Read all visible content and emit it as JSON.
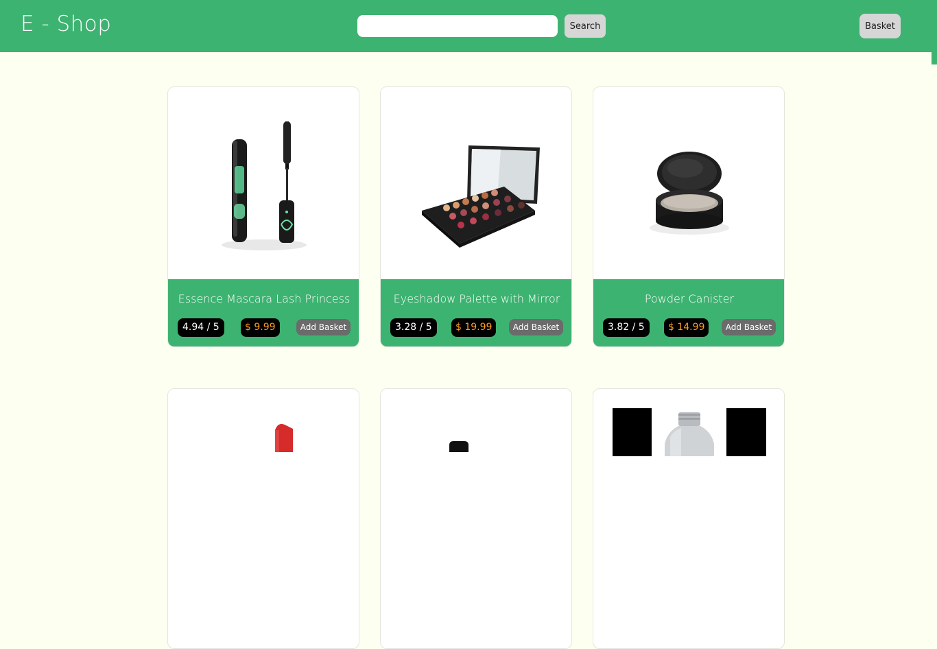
{
  "header": {
    "logo": "E - Shop",
    "search_placeholder": "",
    "search_value": "",
    "search_label": "Search",
    "basket_label": "Basket",
    "colors": {
      "accent": "#3db371",
      "background": "#fdfff0"
    }
  },
  "products": [
    {
      "title": "Essence Mascara Lash Princess",
      "rating": "4.94 / 5",
      "price": "$ 9.99",
      "add_label": "Add Basket",
      "image": "mascara"
    },
    {
      "title": "Eyeshadow Palette with Mirror",
      "rating": "3.28 / 5",
      "price": "$ 19.99",
      "add_label": "Add Basket",
      "image": "eyeshadow-palette"
    },
    {
      "title": "Powder Canister",
      "rating": "3.82 / 5",
      "price": "$ 14.99",
      "add_label": "Add Basket",
      "image": "powder-canister"
    },
    {
      "title": "",
      "rating": "",
      "price": "",
      "add_label": "",
      "image": "red-lipstick"
    },
    {
      "title": "",
      "rating": "",
      "price": "",
      "add_label": "",
      "image": "nail-polish"
    },
    {
      "title": "",
      "rating": "",
      "price": "",
      "add_label": "",
      "image": "perfume-bottle"
    }
  ]
}
